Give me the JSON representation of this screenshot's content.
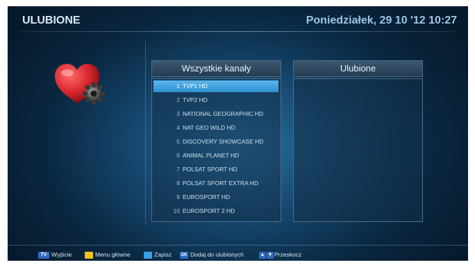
{
  "header": {
    "title": "ULUBIONE",
    "datetime": "Poniedziałek, 29 10 '12 10:27"
  },
  "icon": "heart-gear-icon",
  "all_channels": {
    "label": "Wszystkie kanały",
    "selected_index": 0,
    "items": [
      {
        "num": "1",
        "name": "TVP1 HD"
      },
      {
        "num": "2",
        "name": "TVP2 HD"
      },
      {
        "num": "3",
        "name": "NATIONAL GEOGRAPHIC HD"
      },
      {
        "num": "4",
        "name": "NAT GEO WILD HD"
      },
      {
        "num": "5",
        "name": "DISCOVERY SHOWCASE HD"
      },
      {
        "num": "6",
        "name": "ANIMAL PLANET HD"
      },
      {
        "num": "7",
        "name": "POLSAT SPORT HD"
      },
      {
        "num": "8",
        "name": "POLSAT SPORT EXTRA HD"
      },
      {
        "num": "9",
        "name": "EUROSPORT HD"
      },
      {
        "num": "10",
        "name": "EUROSPORT 2 HD"
      }
    ]
  },
  "favorites": {
    "label": "Ulubione",
    "items": []
  },
  "footer": {
    "tv_badge": "TV",
    "exit_label": "Wyjście",
    "menu_label": "Menu główne",
    "save_label": "Zapisz",
    "ok_badge": "OK",
    "add_label": "Dodaj do ulubionych",
    "skip_label": "Przeskocz"
  },
  "colors": {
    "accent_selected": "#3fa3e3",
    "yellow_key": "#f0c21a",
    "blue_key": "#3aa0e6",
    "heart": "#d8282f"
  }
}
